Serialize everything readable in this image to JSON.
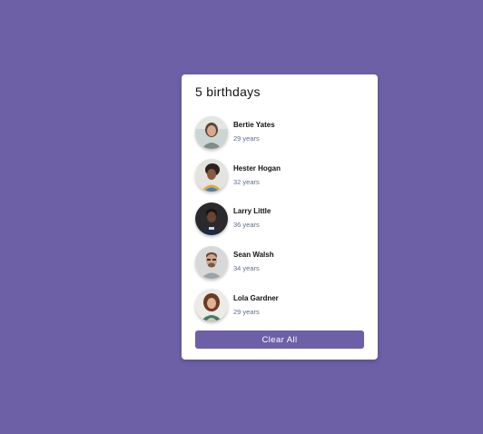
{
  "card": {
    "title": "5 birthdays"
  },
  "people": [
    {
      "name": "Bertie Yates",
      "age": "29 years",
      "avatar": "person-avatar-icon"
    },
    {
      "name": "Hester Hogan",
      "age": "32 years",
      "avatar": "person-avatar-icon"
    },
    {
      "name": "Larry Little",
      "age": "36 years",
      "avatar": "person-avatar-icon"
    },
    {
      "name": "Sean Walsh",
      "age": "34 years",
      "avatar": "person-avatar-icon"
    },
    {
      "name": "Lola Gardner",
      "age": "29 years",
      "avatar": "person-avatar-icon"
    }
  ],
  "actions": {
    "clear_label": "Clear All"
  },
  "colors": {
    "background": "#6d60a7",
    "accent": "#6d60a7",
    "card": "#ffffff",
    "age_text": "#5f6f8a"
  }
}
